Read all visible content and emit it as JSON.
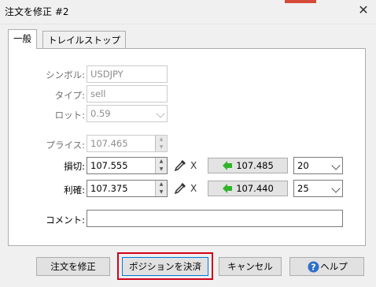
{
  "window": {
    "title": "注文を修正 #2",
    "close_glyph": "✕"
  },
  "tabs": [
    {
      "label": "一般",
      "active": true
    },
    {
      "label": "トレイルストップ",
      "active": false
    }
  ],
  "form": {
    "symbol": {
      "label": "シンボル:",
      "value": "USDJPY"
    },
    "type": {
      "label": "タイプ:",
      "value": "sell"
    },
    "lot": {
      "label": "ロット:",
      "value": "0.59"
    },
    "price": {
      "label": "プライス:",
      "value": "107.465"
    },
    "stop_loss": {
      "label": "損切:",
      "value": "107.555",
      "target_price": "107.485",
      "pips": "20"
    },
    "take_profit": {
      "label": "利確:",
      "value": "107.375",
      "target_price": "107.440",
      "pips": "25"
    },
    "comment": {
      "label": "コメント:",
      "value": ""
    },
    "clear_glyph": "X"
  },
  "buttons": {
    "modify": "注文を修正",
    "close_position": "ポジションを決済",
    "cancel": "キャンセル",
    "help": "ヘルプ"
  },
  "colors": {
    "arrow_green": "#2fb52a",
    "focus_red": "#d0021b",
    "help_blue": "#2f6fc8"
  }
}
